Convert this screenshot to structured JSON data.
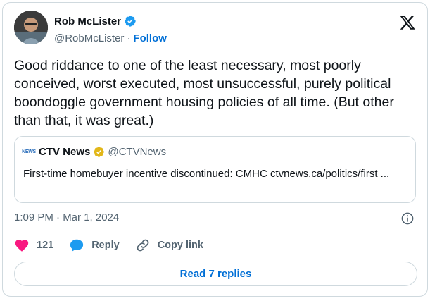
{
  "author": {
    "name": "Rob McLister",
    "handle": "@RobMcLister",
    "separator": "·",
    "follow_label": "Follow"
  },
  "tweet": {
    "text": "Good riddance to one of the least necessary, most poorly conceived, worst executed, most unsuccessful, purely political boondoggle government housing policies of all time. (But other than that, it was great.)",
    "timestamp": "1:09 PM · Mar 1, 2024"
  },
  "quote": {
    "logo_text": "NEWS",
    "name": "CTV News",
    "handle": "@CTVNews",
    "text": "First-time homebuyer incentive discontinued: CMHC ctvnews.ca/politics/first ..."
  },
  "actions": {
    "like_count": "121",
    "reply_label": "Reply",
    "copy_label": "Copy link"
  },
  "read_replies_label": "Read 7 replies",
  "colors": {
    "accent": "#006fd6",
    "like": "#f91880",
    "verified_blue": "#1d9bf0",
    "verified_gold": "#e2b719"
  },
  "icons": [
    "verified-icon",
    "x-logo-icon",
    "gold-check-icon",
    "info-icon",
    "heart-icon",
    "reply-icon",
    "link-icon"
  ]
}
